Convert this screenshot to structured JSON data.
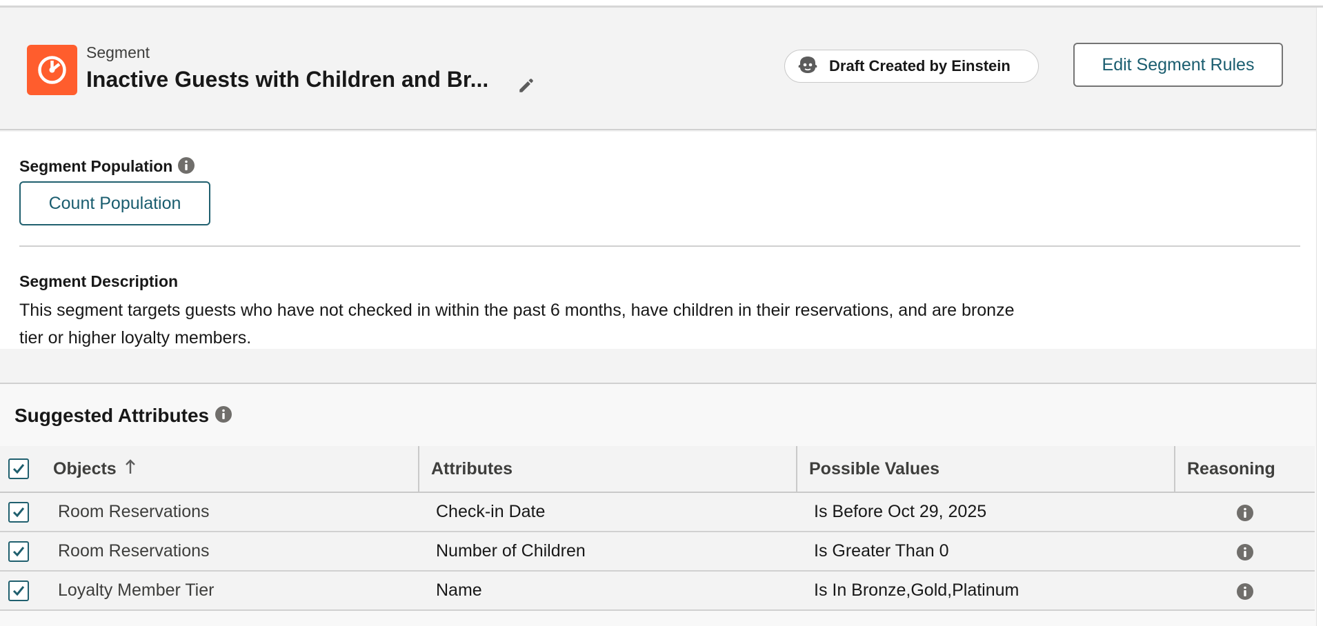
{
  "header": {
    "record_type_label": "Segment",
    "title": "Inactive Guests with Children and Br...",
    "draft_badge": "Draft Created by Einstein",
    "edit_rules_button": "Edit Segment Rules",
    "icon": "segment-pie-icon",
    "brand_color": "#ff5d2d"
  },
  "population": {
    "label": "Segment Population",
    "count_button": "Count Population"
  },
  "description": {
    "label": "Segment Description",
    "text": "This segment targets guests who have not checked in within the past 6 months, have children in their reservations, and are bronze tier or higher loyalty members."
  },
  "suggested_attributes": {
    "heading": "Suggested Attributes",
    "columns": {
      "objects": "Objects",
      "attributes": "Attributes",
      "possible_values": "Possible Values",
      "reasoning": "Reasoning"
    },
    "select_all_checked": true,
    "rows": [
      {
        "object": "Room Reservations",
        "attribute": "Check-in Date",
        "value": "Is Before Oct 29, 2025",
        "checked": true
      },
      {
        "object": "Room Reservations",
        "attribute": "Number of Children",
        "value": "Is Greater Than 0",
        "checked": true
      },
      {
        "object": "Loyalty Member Tier",
        "attribute": "Name",
        "value": "Is In Bronze,Gold,Platinum",
        "checked": true
      }
    ]
  }
}
